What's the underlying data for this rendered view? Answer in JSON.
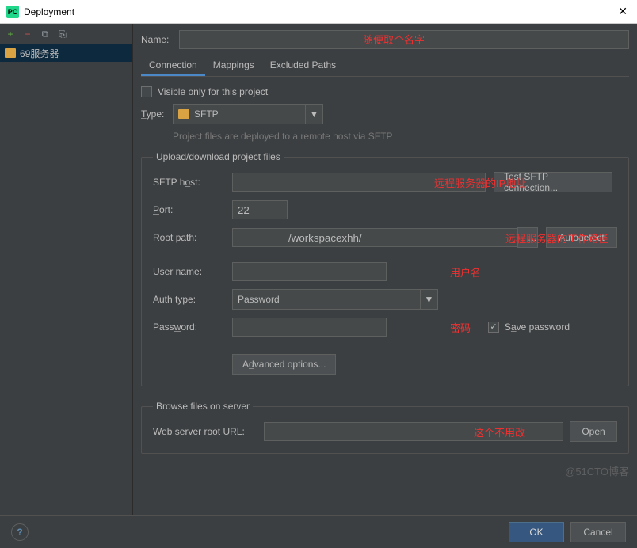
{
  "titlebar": {
    "app_icon": "PC",
    "title": "Deployment"
  },
  "toolbar": {
    "add": "+",
    "remove": "−",
    "copy": "⧉",
    "paste": "⎘"
  },
  "sidebar": {
    "items": [
      {
        "label": "69服务器"
      }
    ]
  },
  "name_row": {
    "label": "Name:"
  },
  "tabs": {
    "connection": "Connection",
    "mappings": "Mappings",
    "excluded": "Excluded Paths"
  },
  "visible_cb": {
    "label": "Visible only for this project"
  },
  "type_row": {
    "label": "Type:",
    "value": "SFTP",
    "hint": "Project files are deployed to a remote host via SFTP"
  },
  "fs_upload": {
    "legend": "Upload/download project files",
    "host_label": "SFTP host:",
    "test_btn": "Test SFTP connection...",
    "port_label": "Port:",
    "port_value": "22",
    "root_label": "Root path:",
    "root_value": "/workspacexhh/",
    "autodetect": "Autodetect",
    "user_label": "User name:",
    "auth_label": "Auth type:",
    "auth_value": "Password",
    "pass_label": "Password:",
    "save_pass": "Save password",
    "advanced": "Advanced options..."
  },
  "fs_browse": {
    "legend": "Browse files on server",
    "url_label": "Web server root URL:",
    "open": "Open"
  },
  "annotations": {
    "name": "随便取个名字",
    "host": "远程服务器的IP地址",
    "root": "远程服务器的工作路径",
    "user": "用户名",
    "pass": "密码",
    "url": "这个不用改"
  },
  "footer": {
    "ok": "OK",
    "cancel": "Cancel"
  },
  "watermark": "@51CTO博客"
}
